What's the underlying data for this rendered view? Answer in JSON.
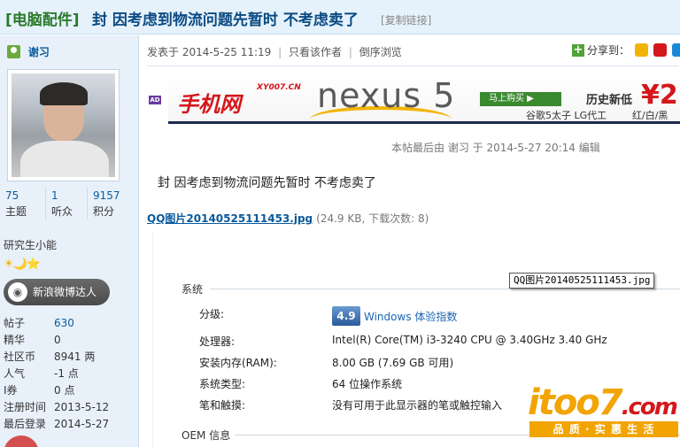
{
  "title_bar": {
    "category": "[电脑配件]",
    "title": "封  因考虑到物流问题先暂时  不考虑卖了",
    "copy_link": "[复制链接]"
  },
  "user": {
    "name": "谢习",
    "stats": [
      {
        "value": "75",
        "label": "主题"
      },
      {
        "value": "1",
        "label": "听众"
      },
      {
        "value": "9157",
        "label": "积分"
      }
    ],
    "rank": "研究生小能",
    "stars": "☀🌙⭐",
    "weibo_button": "新浪微博达人",
    "profile": [
      {
        "key": "帖子",
        "value": "630"
      },
      {
        "key": "精华",
        "value": "0"
      },
      {
        "key": "社区币",
        "value": "8941 两"
      },
      {
        "key": "人气",
        "value": "-1 点"
      },
      {
        "key": "I券",
        "value": "0 点"
      },
      {
        "key": "注册时间",
        "value": "2013-5-12"
      },
      {
        "key": "最后登录",
        "value": "2014-5-27"
      }
    ]
  },
  "post": {
    "posted_at": "发表于 2014-5-25 11:19",
    "sep": "|",
    "author_only": "只看该作者",
    "reverse_view": "倒序浏览",
    "share_label": "分享到：",
    "ad_tag": "AD",
    "banner": {
      "site": "手机网",
      "site_url": "XY007.CN",
      "product": "nexus 5",
      "buy": "马上购买 ▶",
      "history": "历史新低",
      "price": "¥2",
      "sub1": "谷歌5太子 LG代工",
      "sub2": "红/白/黑"
    },
    "edited_note": "本帖最后由 谢习 于 2014-5-27 20:14 编辑",
    "body": "封    因考虑到物流问题先暂时 不考虑卖了",
    "attachment_name": "QQ图片20140525111453.jpg",
    "attachment_info": "(24.9 KB, 下载次数: 8)"
  },
  "screenshot": {
    "section_system": "系统",
    "tooltip": "QQ图片20140525111453.jpg",
    "rating_label": "分级:",
    "rating_value": "4.9",
    "rating_text": "Windows 体验指数",
    "rows": [
      {
        "key": "处理器:",
        "value": "Intel(R) Core(TM) i3-3240 CPU @ 3.40GHz   3.40 GHz"
      },
      {
        "key": "安装内存(RAM):",
        "value": "8.00 GB (7.69 GB 可用)"
      },
      {
        "key": "系统类型:",
        "value": "64 位操作系统"
      },
      {
        "key": "笔和触摸:",
        "value": "没有可用于此显示器的笔或触控输入"
      }
    ],
    "section_oem": "OEM 信息"
  },
  "watermark": {
    "logo": "itoo7",
    "suffix": ".com",
    "slogan": "品 质 · 实 惠  生 活"
  }
}
